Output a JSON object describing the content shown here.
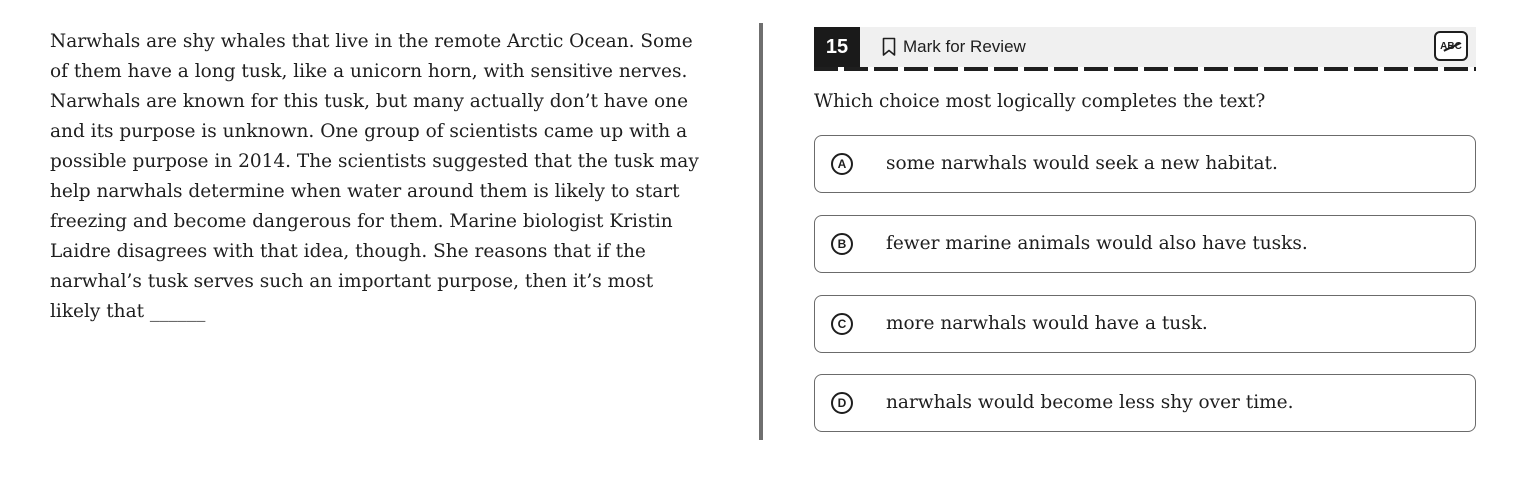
{
  "passage": {
    "text": "Narwhals are shy whales that live in the remote Arctic Ocean. Some of them have a long tusk, like a unicorn horn, with sensitive nerves. Narwhals are known for this tusk, but many actually don’t have one and its purpose is unknown. One group of scientists came up with a possible purpose in 2014. The scientists suggested that the tusk may help narwhals determine when water around them is likely to start freezing and become dangerous for them. Marine biologist Kristin Laidre disagrees with that idea, though. She reasons that if the narwhal’s tusk serves such an important purpose, then it’s most likely that ______"
  },
  "header": {
    "question_number": "15",
    "mark_for_review": "Mark for Review",
    "abc_label": "ABC"
  },
  "question": "Which choice most logically completes the text?",
  "choices": [
    {
      "letter": "A",
      "text": "some narwhals would seek a new habitat."
    },
    {
      "letter": "B",
      "text": "fewer marine animals would also have tusks."
    },
    {
      "letter": "C",
      "text": "more narwhals would have a tusk."
    },
    {
      "letter": "D",
      "text": "narwhals would become less shy over time."
    }
  ],
  "colors": {
    "header_bg": "#f0f0f0",
    "number_bg": "#1a1a1a",
    "divider": "#6f6f6f",
    "border": "#6b6b6b"
  },
  "icons": {
    "bookmark": "bookmark-icon",
    "abc": "strikethrough-abc-icon"
  }
}
